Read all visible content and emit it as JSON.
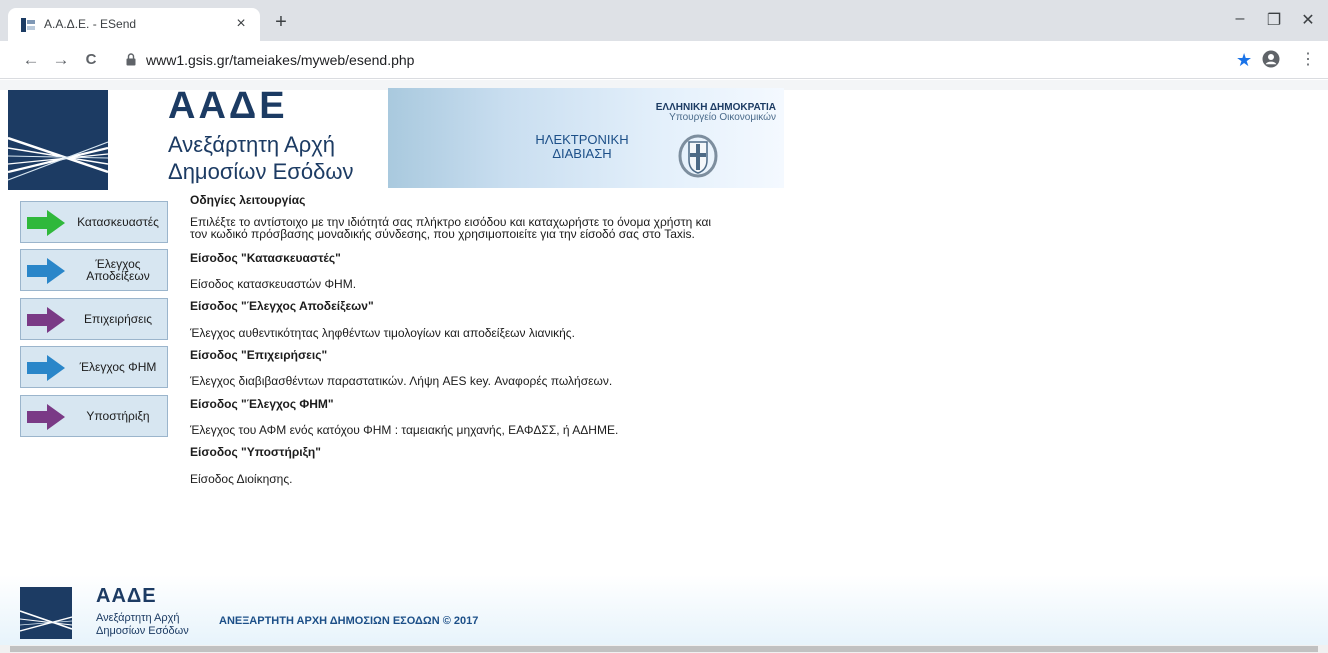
{
  "browser": {
    "tab_title": "Α.Α.Δ.Ε. - ESend",
    "tab_close": "×",
    "new_tab": "+",
    "url": "www1.gsis.gr/tameiakes/myweb/esend.php",
    "win_minimize": "–",
    "win_restore": "❐",
    "win_close": "✕",
    "back": "←",
    "forward": "→",
    "reload": "C",
    "star": "★",
    "menu": "⋮"
  },
  "header": {
    "logo_title": "ΑΑΔΕ",
    "logo_line1": "Ανεξάρτητη Αρχή",
    "logo_line2": "Δημοσίων Εσόδων",
    "republic": "ΕΛΛΗΝΙΚΗ ΔΗΜΟΚΡΑΤΙΑ",
    "ministry": "Υπουργείο Οικονομικών",
    "service_line1": "ΗΛΕΚΤΡΟΝΙΚΗ",
    "service_line2": "ΔΙΑΒΙΑΣΗ"
  },
  "menu": [
    {
      "label": "Κατασκευαστές",
      "color": "#2fb83b"
    },
    {
      "label": "Έλεγχος Αποδείξεων",
      "color": "#2a86c9"
    },
    {
      "label": "Επιχειρήσεις",
      "color": "#7a3a86"
    },
    {
      "label": "Έλεγχος ΦΗΜ",
      "color": "#2a86c9"
    },
    {
      "label": "Υποστήριξη",
      "color": "#7a3a86"
    }
  ],
  "content": {
    "title": "Οδηγίες λειτουργίας",
    "intro_line1": "Επιλέξτε το αντίστοιχο με την ιδιότητά σας πλήκτρο εισόδου και καταχωρήστε το όνομα χρήστη και",
    "intro_line2": "τον κωδικό πρόσβασης μοναδικής σύνδεσης, που χρησιμοποιείτε για την είσοδό σας στο Taxis.",
    "sections": [
      {
        "heading": "Είσοδος \"Κατασκευαστές\"",
        "text": "Είσοδος κατασκευαστών ΦΗΜ."
      },
      {
        "heading": "Είσοδος \"Έλεγχος Αποδείξεων\"",
        "text": "Έλεγχος αυθεντικότητας ληφθέντων τιμολογίων και αποδείξεων λιανικής."
      },
      {
        "heading": "Είσοδος \"Επιχειρήσεις\"",
        "text": "Έλεγχος διαβιβασθέντων παραστατικών. Λήψη AES key. Αναφορές πωλήσεων."
      },
      {
        "heading": "Είσοδος \"Έλεγχος ΦΗΜ\"",
        "text": "Έλεγχος του ΑΦΜ ενός κατόχου ΦΗΜ : ταμειακής μηχανής, ΕΑΦΔΣΣ, ή ΑΔΗΜΕ."
      },
      {
        "heading": "Είσοδος \"Υποστήριξη\"",
        "text": "Είσοδος Διοίκησης."
      }
    ]
  },
  "footer": {
    "logo_title": "ΑΑΔΕ",
    "logo_line1": "Ανεξάρτητη Αρχή",
    "logo_line2": "Δημοσίων Εσόδων",
    "copyright": "ΑΝΕΞΑΡΤΗΤΗ ΑΡΧΗ ΔΗΜΟΣΙΩΝ ΕΣΟΔΩΝ © 2017"
  },
  "colors": {
    "brand": "#1c3b63",
    "menu_bg": "#d7e6f1"
  }
}
